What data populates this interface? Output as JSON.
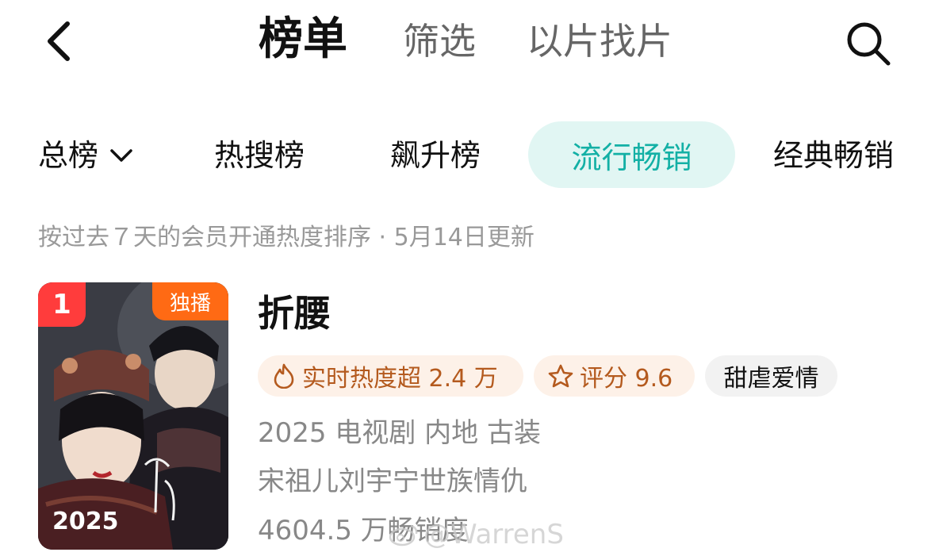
{
  "nav": {
    "tabs": [
      "榜单",
      "筛选",
      "以片找片"
    ]
  },
  "categories": {
    "total": "总榜",
    "items": [
      "热搜榜",
      "飙升榜",
      "流行畅销",
      "经典畅销"
    ]
  },
  "note": "按过去７天的会员开通热度排序 · 5月14日更新",
  "item": {
    "rank": "1",
    "badge": "独播",
    "poster_year": "2025",
    "title": "折腰",
    "heat_label": "实时热度超 2.4 万",
    "score_label": "评分 9.6",
    "genre_tag": "甜虐爱情",
    "meta_line": "2025 电视剧 内地 古装",
    "cast_line": "宋祖儿刘宇宁世族情仇",
    "sales_line": "4604.5 万畅销度"
  },
  "watermark": "@WarrenS",
  "colors": {
    "accent": "#13b0a5",
    "pill_bg": "#e1f6f3",
    "rank_red": "#ff3c3c",
    "badge_orange": "#ff6a14",
    "tag_orange_text": "#b45a1e"
  }
}
